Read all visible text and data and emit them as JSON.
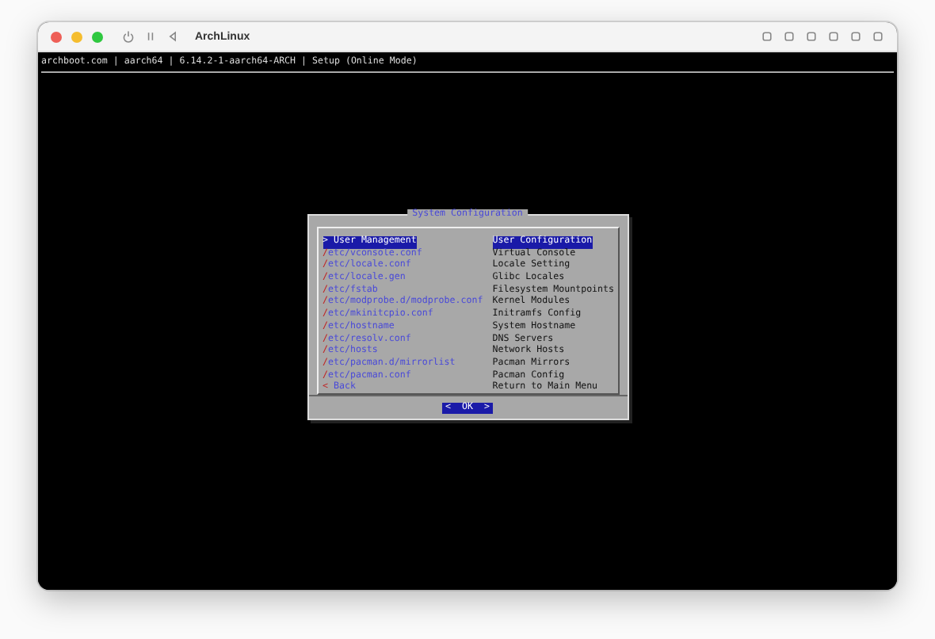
{
  "window": {
    "title": "ArchLinux"
  },
  "terminal": {
    "header": "archboot.com | aarch64 | 6.14.2-1-aarch64-ARCH | Setup (Online Mode)"
  },
  "dialog": {
    "title": "System Configuration",
    "items": [
      {
        "tag": "> User Management",
        "description": "User Configuration",
        "selected": true
      },
      {
        "tag": "/etc/vconsole.conf",
        "description": "Virtual Console",
        "selected": false
      },
      {
        "tag": "/etc/locale.conf",
        "description": "Locale Setting",
        "selected": false
      },
      {
        "tag": "/etc/locale.gen",
        "description": "Glibc Locales",
        "selected": false
      },
      {
        "tag": "/etc/fstab",
        "description": "Filesystem Mountpoints",
        "selected": false
      },
      {
        "tag": "/etc/modprobe.d/modprobe.conf",
        "description": "Kernel Modules",
        "selected": false
      },
      {
        "tag": "/etc/mkinitcpio.conf",
        "description": "Initramfs Config",
        "selected": false
      },
      {
        "tag": "/etc/hostname",
        "description": "System Hostname",
        "selected": false
      },
      {
        "tag": "/etc/resolv.conf",
        "description": "DNS Servers",
        "selected": false
      },
      {
        "tag": "/etc/hosts",
        "description": "Network Hosts",
        "selected": false
      },
      {
        "tag": "/etc/pacman.d/mirrorlist",
        "description": "Pacman Mirrors",
        "selected": false
      },
      {
        "tag": "/etc/pacman.conf",
        "description": "Pacman Config",
        "selected": false
      },
      {
        "tag": "< Back",
        "description": "Return to Main Menu",
        "selected": false
      }
    ],
    "button": {
      "label": "<  OK  >",
      "selected": true
    }
  }
}
